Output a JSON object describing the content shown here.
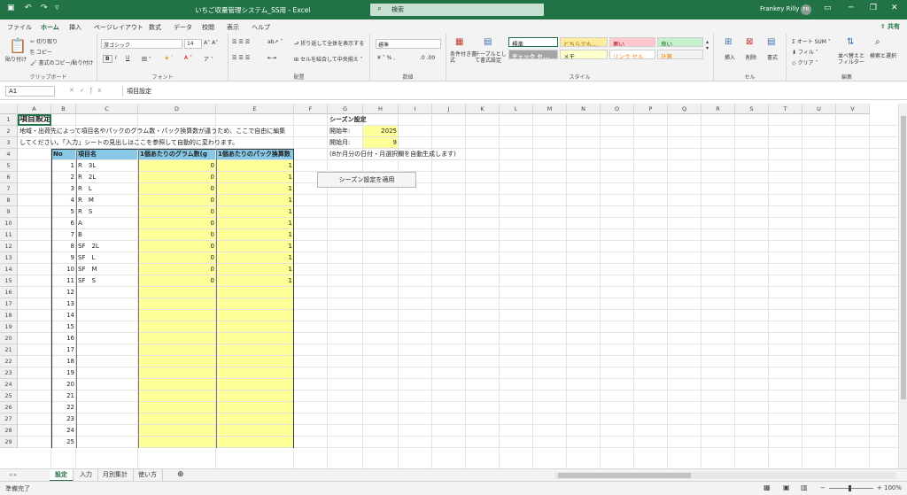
{
  "titlebar": {
    "doc_title": "いちご収量管理システム_SS用 - Excel",
    "search_placeholder": "検索",
    "user_name": "Frankey Rilly",
    "user_initials": "FR"
  },
  "ribbon_tabs": [
    "ファイル",
    "ホーム",
    "挿入",
    "ページレイアウト",
    "数式",
    "データ",
    "校閲",
    "表示",
    "ヘルプ"
  ],
  "share_label": "共有",
  "clipboard": {
    "paste": "貼り付け",
    "cut": "切り取り",
    "copy": "コピー",
    "format_painter": "書式のコピー/貼り付け",
    "label": "クリップボード"
  },
  "font": {
    "name": "游ゴシック",
    "size": "14",
    "label": "フォント",
    "bold": "B",
    "italic": "I",
    "underline": "U"
  },
  "alignment": {
    "wrap": "折り返して全体を表示する",
    "merge": "セルを結合して中央揃え",
    "label": "配置"
  },
  "number": {
    "format": "標準",
    "label": "数値"
  },
  "styles": {
    "cond_format": "条件付き書式",
    "table_format": "テーブルとして書式設定",
    "cells": [
      "標準",
      "どちらでも...",
      "悪い",
      "良い",
      "チェック セ...",
      "メモ",
      "リンク セル",
      "計算"
    ],
    "label": "スタイル"
  },
  "cells_group": {
    "insert": "挿入",
    "delete": "削除",
    "format": "書式",
    "label": "セル"
  },
  "editing": {
    "autosum": "オート SUM",
    "fill": "フィル",
    "clear": "クリア",
    "sort": "並べ替えとフィルター",
    "find": "検索と選択",
    "label": "編集"
  },
  "formula_bar": {
    "name_box": "A1",
    "content": "項目設定"
  },
  "columns": [
    "A",
    "B",
    "C",
    "D",
    "E",
    "F",
    "G",
    "H",
    "I",
    "J",
    "K",
    "L",
    "M",
    "N",
    "O",
    "P",
    "Q",
    "R",
    "S",
    "T",
    "U",
    "V"
  ],
  "rows": [
    "1",
    "2",
    "3",
    "4",
    "5",
    "6",
    "7",
    "8",
    "9",
    "10",
    "11",
    "12",
    "13",
    "14",
    "15",
    "16",
    "17",
    "18",
    "19",
    "20",
    "21",
    "22",
    "23",
    "24",
    "25",
    "26",
    "27",
    "28",
    "29"
  ],
  "sheet": {
    "title": "項目設定",
    "description_1": "地域・出荷先によって項目名やパックのグラム数・パック換算数が違うため、ここで自由に編集",
    "description_2": "してください。「入力」シートの見出しはここを参照して自動的に変わります。",
    "headers": {
      "no": "No",
      "item": "項目名",
      "grams": "1個あたりのグラム数(g",
      "packs": "1個あたりのパック換算数"
    },
    "items": [
      {
        "no": "1",
        "name": "R　3L",
        "grams": "0",
        "packs": "1"
      },
      {
        "no": "2",
        "name": "R　2L",
        "grams": "0",
        "packs": "1"
      },
      {
        "no": "3",
        "name": "R　L",
        "grams": "0",
        "packs": "1"
      },
      {
        "no": "4",
        "name": "R　M",
        "grams": "0",
        "packs": "1"
      },
      {
        "no": "5",
        "name": "R　S",
        "grams": "0",
        "packs": "1"
      },
      {
        "no": "6",
        "name": "A",
        "grams": "0",
        "packs": "1"
      },
      {
        "no": "7",
        "name": "B",
        "grams": "0",
        "packs": "1"
      },
      {
        "no": "8",
        "name": "SF　2L",
        "grams": "0",
        "packs": "1"
      },
      {
        "no": "9",
        "name": "SF　L",
        "grams": "0",
        "packs": "1"
      },
      {
        "no": "10",
        "name": "SF　M",
        "grams": "0",
        "packs": "1"
      },
      {
        "no": "11",
        "name": "SF　S",
        "grams": "0",
        "packs": "1"
      },
      {
        "no": "12",
        "name": "",
        "grams": "",
        "packs": ""
      },
      {
        "no": "13",
        "name": "",
        "grams": "",
        "packs": ""
      },
      {
        "no": "14",
        "name": "",
        "grams": "",
        "packs": ""
      },
      {
        "no": "15",
        "name": "",
        "grams": "",
        "packs": ""
      },
      {
        "no": "16",
        "name": "",
        "grams": "",
        "packs": ""
      },
      {
        "no": "17",
        "name": "",
        "grams": "",
        "packs": ""
      },
      {
        "no": "18",
        "name": "",
        "grams": "",
        "packs": ""
      },
      {
        "no": "19",
        "name": "",
        "grams": "",
        "packs": ""
      },
      {
        "no": "20",
        "name": "",
        "grams": "",
        "packs": ""
      },
      {
        "no": "21",
        "name": "",
        "grams": "",
        "packs": ""
      },
      {
        "no": "22",
        "name": "",
        "grams": "",
        "packs": ""
      },
      {
        "no": "23",
        "name": "",
        "grams": "",
        "packs": ""
      },
      {
        "no": "24",
        "name": "",
        "grams": "",
        "packs": ""
      },
      {
        "no": "25",
        "name": "",
        "grams": "",
        "packs": ""
      }
    ],
    "season": {
      "title": "シーズン設定",
      "start_year_label": "開始年:",
      "start_year": "2025",
      "start_month_label": "開始月:",
      "start_month": "9",
      "note": "(8か月分の日付・月選択欄を自動生成します)",
      "apply_button": "シーズン設定を適用"
    }
  },
  "sheet_tabs": [
    "設定",
    "入力",
    "月別集計",
    "使い方"
  ],
  "status": {
    "ready": "準備完了",
    "zoom": "100%"
  },
  "colors": {
    "excel_green": "#217346",
    "input_yellow": "#ffff99",
    "header_blue": "#87c8e6"
  }
}
